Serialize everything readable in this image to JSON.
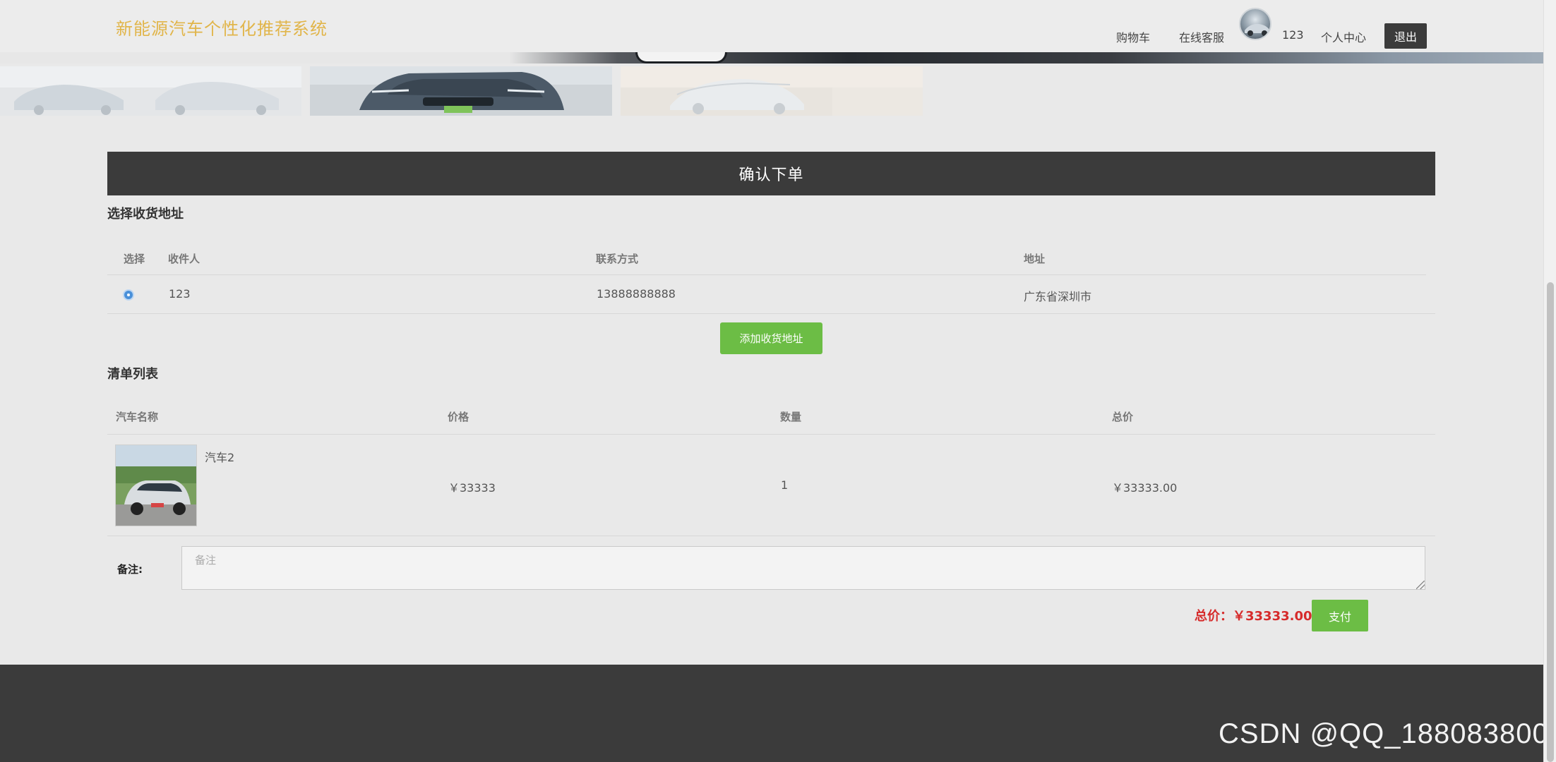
{
  "header": {
    "site_title": "新能源汽车个性化推荐系统",
    "nav": {
      "cart": "购物车",
      "service": "在线客服",
      "username": "123",
      "profile": "个人中心",
      "logout": "退出"
    }
  },
  "confirm": {
    "title": "确认下单",
    "address_section_title": "选择收货地址",
    "address_columns": [
      "选择",
      "收件人",
      "联系方式",
      "地址"
    ],
    "addresses": [
      {
        "selected": true,
        "recipient": "123",
        "phone": "13888888888",
        "address": "广东省深圳市"
      }
    ],
    "add_address_label": "添加收货地址",
    "list_section_title": "清单列表",
    "list_columns": [
      "汽车名称",
      "价格",
      "数量",
      "总价"
    ],
    "items": [
      {
        "name": "汽车2",
        "price": "￥33333",
        "quantity": "1",
        "subtotal": "￥33333.00"
      }
    ],
    "remark_label": "备注:",
    "remark_placeholder": "备注",
    "remark_value": "",
    "total_label": "总价：￥33333.00",
    "pay_label": "支付"
  },
  "watermark": "CSDN @QQ_188083800",
  "colors": {
    "title_gold": "#e1b54a",
    "dark_bar": "#3b3b3b",
    "green_button": "#6cbd45",
    "total_red": "#d62b2b",
    "radio_blue": "#4a90d9"
  },
  "icons": {
    "avatar": "user-avatar-car-photo",
    "radio": "radio-selected",
    "car_thumbnail": "car-photo-thumbnail"
  }
}
